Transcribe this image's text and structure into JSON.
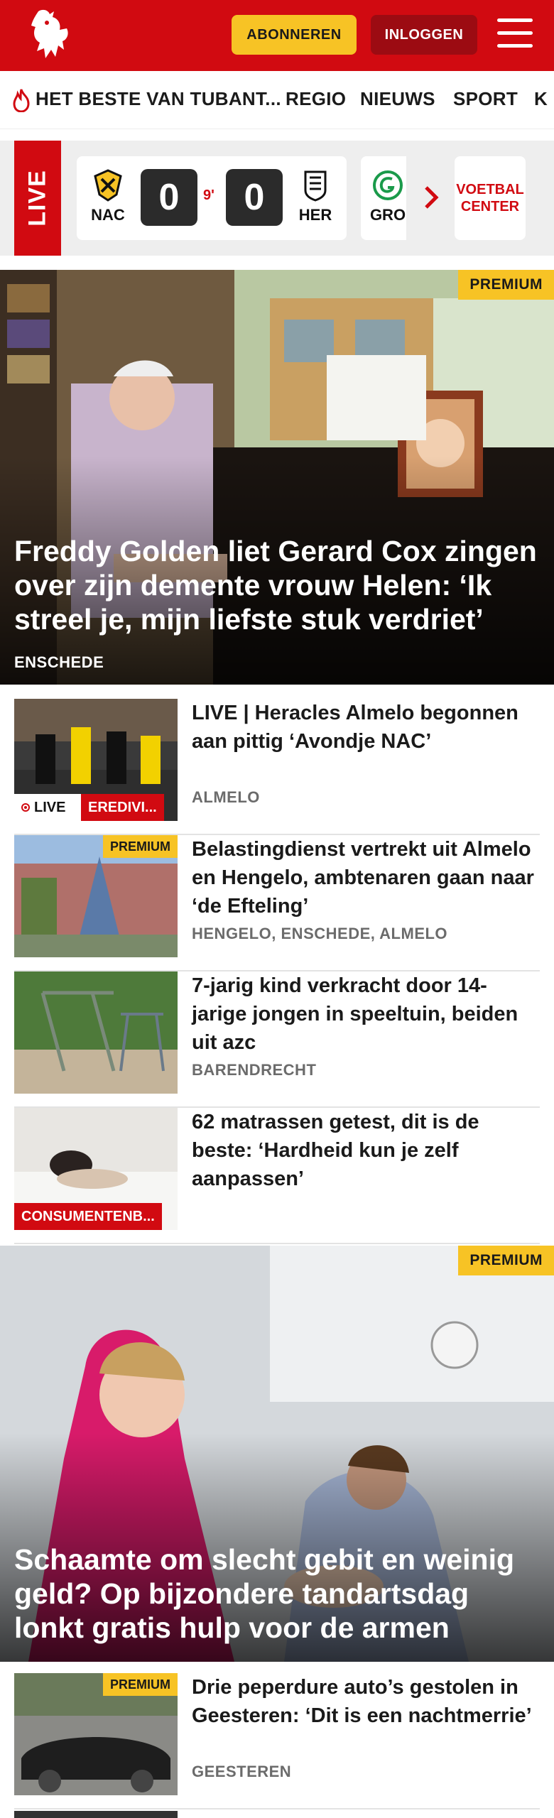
{
  "header": {
    "subscribe_label": "ABONNEREN",
    "login_label": "INLOGGEN",
    "brand_color": "#d10a11",
    "accent_color": "#f7c325"
  },
  "nav": {
    "items": [
      "HET BESTE VAN TUBANT...",
      "REGIO",
      "NIEUWS",
      "SPORT",
      "K"
    ]
  },
  "live": {
    "tag": "LIVE",
    "match": {
      "home": "NAC",
      "away": "HER",
      "home_score": "0",
      "away_score": "0",
      "minute": "9'"
    },
    "next_team": "GRO",
    "voetbal_center": "VOETBAL CENTER"
  },
  "hero1": {
    "badge": "PREMIUM",
    "title": "Freddy Golden liet Gerard Cox zingen over zijn demente vrouw Helen: ‘Ik streel je, mijn liefste stuk verdriet’",
    "location": "ENSCHEDE"
  },
  "articles": [
    {
      "title": "LIVE | Heracles Almelo begonnen aan pittig ‘Avondje NAC’",
      "location": "ALMELO",
      "live_chip": "LIVE",
      "label": "EREDIVI..."
    },
    {
      "title": "Belastingdienst vertrekt uit Almelo en Hengelo, ambtenaren gaan naar ‘de Efteling’",
      "location": "HENGELO, ENSCHEDE, ALMELO",
      "badge": "PREMIUM"
    },
    {
      "title": "7-jarig kind verkracht door 14-jarige jongen in speeltuin, beiden uit azc",
      "location": "BARENDRECHT"
    },
    {
      "title": "62 matrassen getest, dit is de beste: ‘Hardheid kun je zelf aanpassen’",
      "location": "",
      "label": "CONSUMENTENB..."
    }
  ],
  "hero2": {
    "badge": "PREMIUM",
    "title": "Schaamte om slecht gebit en weinig geld? Op bijzondere tandartsdag lonkt gratis hulp voor de armen"
  },
  "articles2": [
    {
      "title": "Drie peperdure auto’s gestolen in Geesteren: ‘Dit is een nachtmer­rie’",
      "location": "GEESTEREN",
      "badge": "PREMIUM"
    }
  ]
}
